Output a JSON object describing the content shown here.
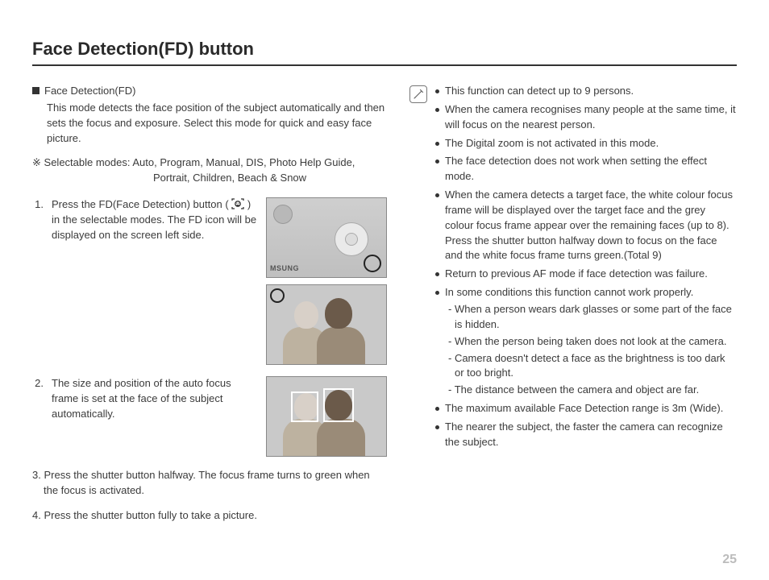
{
  "title": "Face Detection(FD) button",
  "page_number": "25",
  "intro": {
    "heading": "Face Detection(FD)",
    "body": "This mode detects the face position of the subject automatically and then sets the focus and exposure. Select this mode for quick and easy face picture."
  },
  "modes": {
    "prefix": "※",
    "label": "Selectable modes:",
    "line1": "Auto, Program, Manual, DIS, Photo Help Guide,",
    "line2": "Portrait, Children, Beach & Snow"
  },
  "steps": [
    {
      "num": "1.",
      "text_a": "Press the FD(Face Detection) button (",
      "text_b": ") in the selectable modes. The FD icon will be displayed on the screen left side."
    },
    {
      "num": "2.",
      "text": "The size and position of the auto focus frame is set at the face of the subject automatically."
    },
    {
      "num": "3.",
      "text": "Press the shutter button halfway. The focus frame turns to green when the focus is activated."
    },
    {
      "num": "4.",
      "text": "Press the shutter button fully to take a picture."
    }
  ],
  "thumb_brand": "MSUNG",
  "notes": [
    {
      "text": "This function can detect up to 9 persons."
    },
    {
      "text": "When the camera recognises many people at the same time, it will focus on the nearest person."
    },
    {
      "text": "The Digital zoom is not activated in this mode."
    },
    {
      "text": "The face detection does not work when setting the effect mode."
    },
    {
      "text": "When the camera detects a target face, the white colour focus frame will be displayed over the target face and the grey colour focus frame appear over the remaining faces (up to 8). Press the shutter button halfway down to focus on the face and the white focus frame turns green.(Total 9)"
    },
    {
      "text": "Return to previous AF mode if face detection was failure."
    },
    {
      "text": "In some conditions this function cannot work properly.",
      "sub": [
        "- When a person wears dark glasses or some part of the face is hidden.",
        "- When the person being taken does not look at the camera.",
        "- Camera doesn't detect a face as the brightness is too dark or too bright.",
        "- The distance between the camera and object are far."
      ]
    },
    {
      "text": "The maximum available Face Detection range is 3m (Wide)."
    },
    {
      "text": "The nearer the subject, the faster the camera can recognize the subject."
    }
  ]
}
